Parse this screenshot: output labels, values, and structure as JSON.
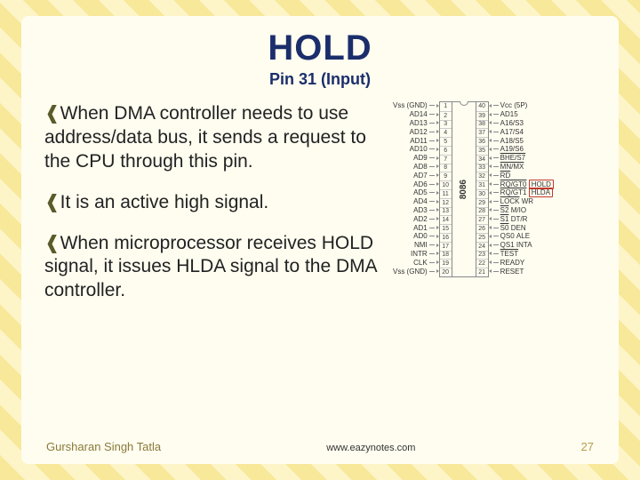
{
  "title": "HOLD",
  "subtitle": "Pin 31 (Input)",
  "bullets": [
    "When DMA controller needs to use address/data bus, it sends a request to the CPU through this pin.",
    "It is an active high signal.",
    "When microprocessor receives HOLD signal, it issues HLDA signal to the DMA controller."
  ],
  "chip": {
    "name": "8086",
    "left_pins": [
      {
        "n": 1,
        "label": "Vss (GND)"
      },
      {
        "n": 2,
        "label": "AD14"
      },
      {
        "n": 3,
        "label": "AD13"
      },
      {
        "n": 4,
        "label": "AD12"
      },
      {
        "n": 5,
        "label": "AD11"
      },
      {
        "n": 6,
        "label": "AD10"
      },
      {
        "n": 7,
        "label": "AD9"
      },
      {
        "n": 8,
        "label": "AD8"
      },
      {
        "n": 9,
        "label": "AD7"
      },
      {
        "n": 10,
        "label": "AD6"
      },
      {
        "n": 11,
        "label": "AD5"
      },
      {
        "n": 12,
        "label": "AD4"
      },
      {
        "n": 13,
        "label": "AD3"
      },
      {
        "n": 14,
        "label": "AD2"
      },
      {
        "n": 15,
        "label": "AD1"
      },
      {
        "n": 16,
        "label": "AD0"
      },
      {
        "n": 17,
        "label": "NMI"
      },
      {
        "n": 18,
        "label": "INTR"
      },
      {
        "n": 19,
        "label": "CLK"
      },
      {
        "n": 20,
        "label": "Vss (GND)"
      }
    ],
    "right_pins": [
      {
        "n": 40,
        "label": "Vcc (5P)"
      },
      {
        "n": 39,
        "label": "AD15"
      },
      {
        "n": 38,
        "label": "A16/S3"
      },
      {
        "n": 37,
        "label": "A17/S4"
      },
      {
        "n": 36,
        "label": "A18/S5"
      },
      {
        "n": 35,
        "label": "A19/S6"
      },
      {
        "n": 34,
        "label": "BHE/S7",
        "over": "BHE"
      },
      {
        "n": 33,
        "label": "MN/MX",
        "over": "MX"
      },
      {
        "n": 32,
        "label": "RD",
        "over": "RD"
      },
      {
        "n": 31,
        "label": "RQ/GT0",
        "alt": "HOLD",
        "over": "RQ/GT0",
        "hl": true
      },
      {
        "n": 30,
        "label": "RQ/GT1",
        "alt": "HLDA",
        "over": "RQ/GT1",
        "hl": true
      },
      {
        "n": 29,
        "label": "LOCK",
        "alt": "WR",
        "over": "LOCK"
      },
      {
        "n": 28,
        "label": "S2",
        "alt": "M/IO",
        "over": "S2"
      },
      {
        "n": 27,
        "label": "S1",
        "alt": "DT/R",
        "over": "S1"
      },
      {
        "n": 26,
        "label": "S0",
        "alt": "DEN",
        "over": "S0"
      },
      {
        "n": 25,
        "label": "QS0",
        "alt": "ALE"
      },
      {
        "n": 24,
        "label": "QS1",
        "alt": "INTA"
      },
      {
        "n": 23,
        "label": "TEST",
        "over": "TEST"
      },
      {
        "n": 22,
        "label": "READY"
      },
      {
        "n": 21,
        "label": "RESET"
      }
    ]
  },
  "footer": {
    "author": "Gursharan Singh Tatla",
    "site": "www.eazynotes.com",
    "page": "27"
  }
}
